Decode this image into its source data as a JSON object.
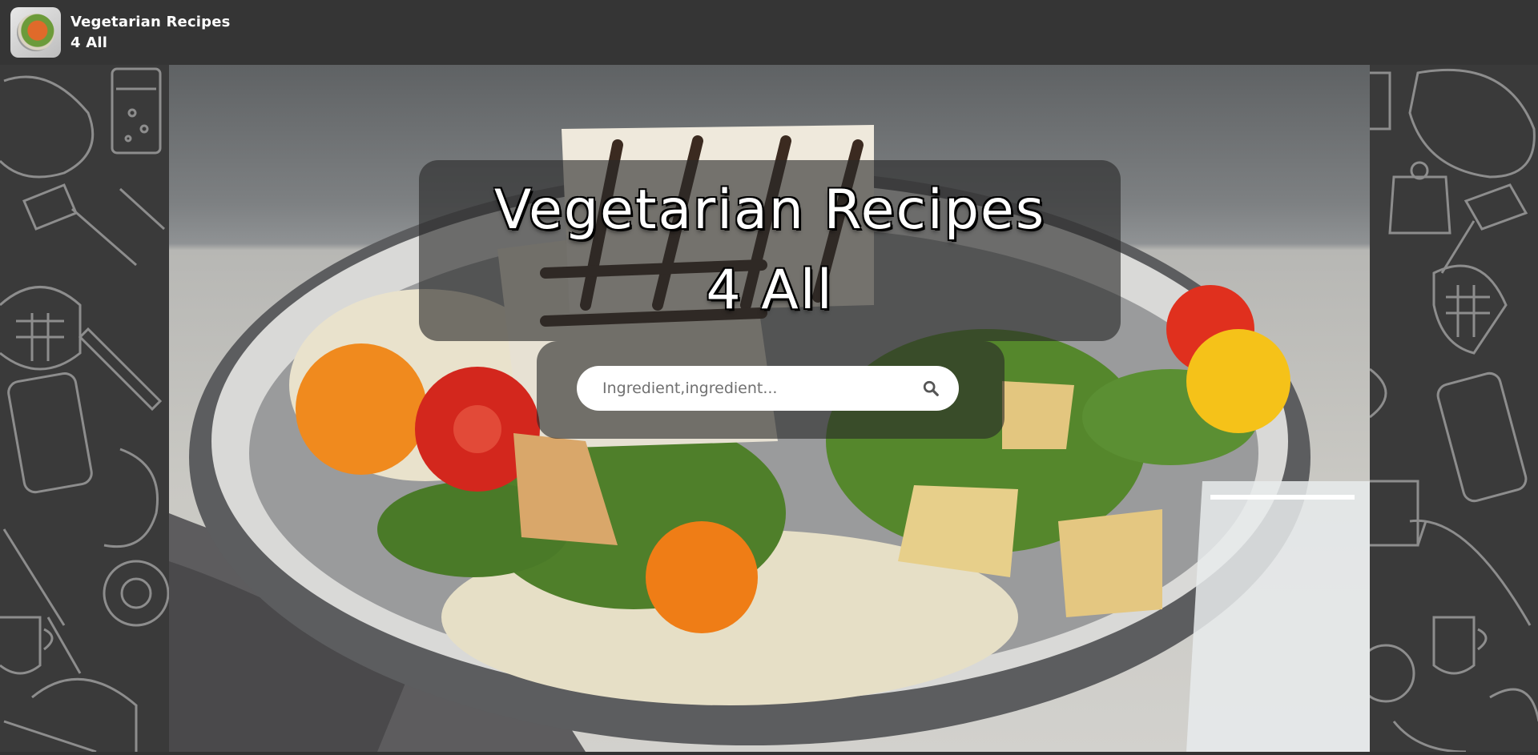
{
  "header": {
    "brand_line1": "Vegetarian Recipes",
    "brand_line2": "4 All",
    "logo_icon": "salad-bowl-logo"
  },
  "hero": {
    "title_line1": "Vegetarian Recipes",
    "title_line2": "4 All",
    "background": "grilled-tofu-salad-bowl-photo"
  },
  "search": {
    "placeholder": "Ingredient,ingredient...",
    "value": "",
    "icon": "search-icon"
  },
  "colors": {
    "topbar": "#353535",
    "side_pattern_bg": "#3a3a3a",
    "overlay": "rgba(40,40,40,0.62)",
    "title_text": "#ffffff"
  }
}
